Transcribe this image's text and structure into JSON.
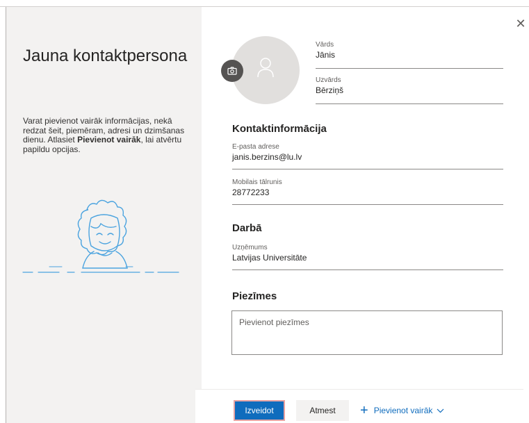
{
  "dialog": {
    "title": "Jauna kontaktpersona",
    "description_before": "Varat pievienot vairāk informācijas, nekā redzat šeit, piemēram, adresi un dzimšanas dienu. Atlasiet ",
    "description_bold": "Pievienot vairāk",
    "description_after": ", lai atvērtu papildu opcijas.",
    "close_icon": "close-icon",
    "close_glyph": "✕"
  },
  "name": {
    "first_label": "Vārds",
    "first_value": "Jānis",
    "last_label": "Uzvārds",
    "last_value": "Bērziņš"
  },
  "contact": {
    "section_title": "Kontaktinformācija",
    "email_label": "E-pasta adrese",
    "email_value": "janis.berzins@lu.lv",
    "phone_label": "Mobilais tālrunis",
    "phone_value": "28772233"
  },
  "work": {
    "section_title": "Darbā",
    "company_label": "Uzņēmums",
    "company_value": "Latvijas Universitāte"
  },
  "notes": {
    "section_title": "Piezīmes",
    "placeholder": "Pievienot piezīmes"
  },
  "footer": {
    "create_label": "Izveidot",
    "discard_label": "Atmest",
    "add_more_label": "Pievienot vairāk",
    "plus_glyph": "+",
    "chevron_glyph": "⌵"
  },
  "colors": {
    "accent": "#0f6cbd",
    "left_panel_bg": "#f3f2f1",
    "illustration": "#4aa3df"
  }
}
